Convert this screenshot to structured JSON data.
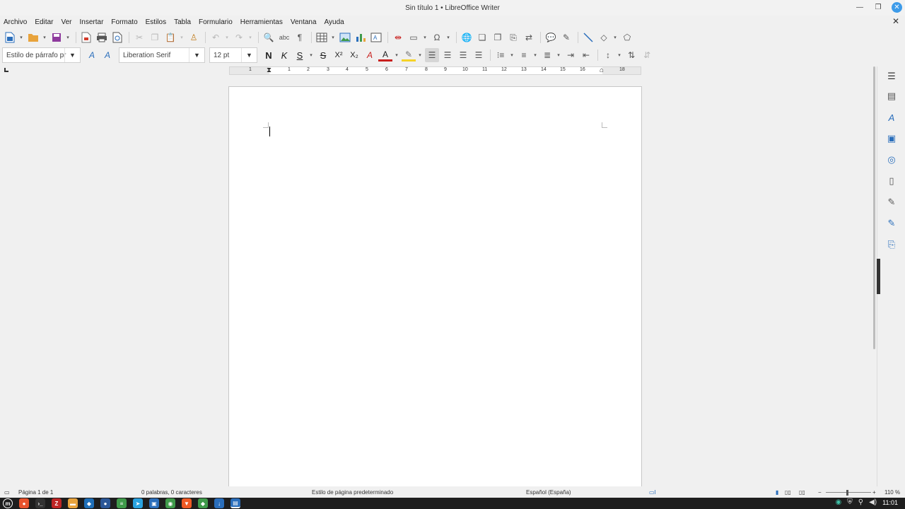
{
  "window": {
    "title": "Sin título 1 • LibreOffice Writer"
  },
  "menu": [
    "Archivo",
    "Editar",
    "Ver",
    "Insertar",
    "Formato",
    "Estilos",
    "Tabla",
    "Formulario",
    "Herramientas",
    "Ventana",
    "Ayuda"
  ],
  "formatting": {
    "paragraph_style": "Estilo de párrafo pr",
    "font_name": "Liberation Serif",
    "font_size": "12 pt",
    "bold_label": "N",
    "italic_label": "K",
    "underline_label": "S",
    "strike_label": "S",
    "superscript_label": "X²",
    "subscript_label": "X₂"
  },
  "ruler": {
    "ticks": [
      "1",
      "1",
      "2",
      "3",
      "4",
      "5",
      "6",
      "7",
      "8",
      "9",
      "10",
      "11",
      "12",
      "13",
      "14",
      "15",
      "16",
      "18"
    ]
  },
  "status": {
    "page": "Página 1 de 1",
    "words": "0 palabras, 0 caracteres",
    "page_style": "Estilo de página predeterminado",
    "language": "Español (España)",
    "zoom": "110 %"
  },
  "taskbar": {
    "clock": "11:01"
  },
  "colors": {
    "accent": "#2a6ebb",
    "close_button": "#3d9be9",
    "font_color": "#c8201e",
    "highlight": "#f5d327"
  }
}
